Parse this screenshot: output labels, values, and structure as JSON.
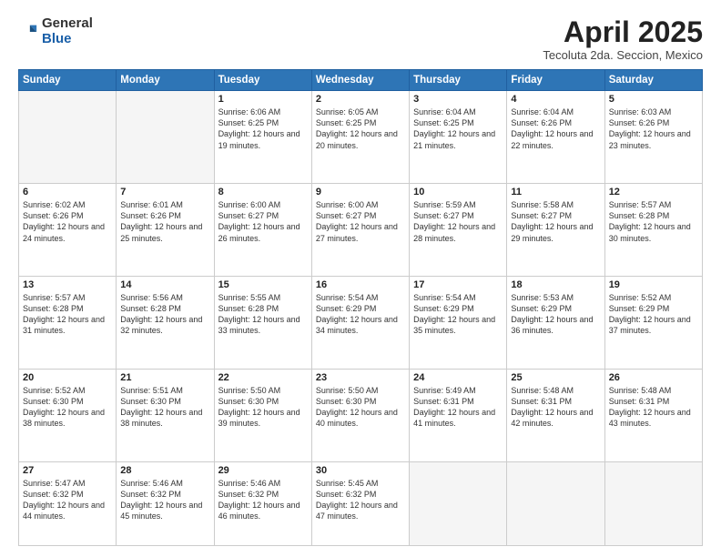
{
  "logo": {
    "general": "General",
    "blue": "Blue"
  },
  "title": "April 2025",
  "location": "Tecoluta 2da. Seccion, Mexico",
  "days_header": [
    "Sunday",
    "Monday",
    "Tuesday",
    "Wednesday",
    "Thursday",
    "Friday",
    "Saturday"
  ],
  "weeks": [
    [
      {
        "day": "",
        "info": ""
      },
      {
        "day": "",
        "info": ""
      },
      {
        "day": "1",
        "info": "Sunrise: 6:06 AM\nSunset: 6:25 PM\nDaylight: 12 hours and 19 minutes."
      },
      {
        "day": "2",
        "info": "Sunrise: 6:05 AM\nSunset: 6:25 PM\nDaylight: 12 hours and 20 minutes."
      },
      {
        "day": "3",
        "info": "Sunrise: 6:04 AM\nSunset: 6:25 PM\nDaylight: 12 hours and 21 minutes."
      },
      {
        "day": "4",
        "info": "Sunrise: 6:04 AM\nSunset: 6:26 PM\nDaylight: 12 hours and 22 minutes."
      },
      {
        "day": "5",
        "info": "Sunrise: 6:03 AM\nSunset: 6:26 PM\nDaylight: 12 hours and 23 minutes."
      }
    ],
    [
      {
        "day": "6",
        "info": "Sunrise: 6:02 AM\nSunset: 6:26 PM\nDaylight: 12 hours and 24 minutes."
      },
      {
        "day": "7",
        "info": "Sunrise: 6:01 AM\nSunset: 6:26 PM\nDaylight: 12 hours and 25 minutes."
      },
      {
        "day": "8",
        "info": "Sunrise: 6:00 AM\nSunset: 6:27 PM\nDaylight: 12 hours and 26 minutes."
      },
      {
        "day": "9",
        "info": "Sunrise: 6:00 AM\nSunset: 6:27 PM\nDaylight: 12 hours and 27 minutes."
      },
      {
        "day": "10",
        "info": "Sunrise: 5:59 AM\nSunset: 6:27 PM\nDaylight: 12 hours and 28 minutes."
      },
      {
        "day": "11",
        "info": "Sunrise: 5:58 AM\nSunset: 6:27 PM\nDaylight: 12 hours and 29 minutes."
      },
      {
        "day": "12",
        "info": "Sunrise: 5:57 AM\nSunset: 6:28 PM\nDaylight: 12 hours and 30 minutes."
      }
    ],
    [
      {
        "day": "13",
        "info": "Sunrise: 5:57 AM\nSunset: 6:28 PM\nDaylight: 12 hours and 31 minutes."
      },
      {
        "day": "14",
        "info": "Sunrise: 5:56 AM\nSunset: 6:28 PM\nDaylight: 12 hours and 32 minutes."
      },
      {
        "day": "15",
        "info": "Sunrise: 5:55 AM\nSunset: 6:28 PM\nDaylight: 12 hours and 33 minutes."
      },
      {
        "day": "16",
        "info": "Sunrise: 5:54 AM\nSunset: 6:29 PM\nDaylight: 12 hours and 34 minutes."
      },
      {
        "day": "17",
        "info": "Sunrise: 5:54 AM\nSunset: 6:29 PM\nDaylight: 12 hours and 35 minutes."
      },
      {
        "day": "18",
        "info": "Sunrise: 5:53 AM\nSunset: 6:29 PM\nDaylight: 12 hours and 36 minutes."
      },
      {
        "day": "19",
        "info": "Sunrise: 5:52 AM\nSunset: 6:29 PM\nDaylight: 12 hours and 37 minutes."
      }
    ],
    [
      {
        "day": "20",
        "info": "Sunrise: 5:52 AM\nSunset: 6:30 PM\nDaylight: 12 hours and 38 minutes."
      },
      {
        "day": "21",
        "info": "Sunrise: 5:51 AM\nSunset: 6:30 PM\nDaylight: 12 hours and 38 minutes."
      },
      {
        "day": "22",
        "info": "Sunrise: 5:50 AM\nSunset: 6:30 PM\nDaylight: 12 hours and 39 minutes."
      },
      {
        "day": "23",
        "info": "Sunrise: 5:50 AM\nSunset: 6:30 PM\nDaylight: 12 hours and 40 minutes."
      },
      {
        "day": "24",
        "info": "Sunrise: 5:49 AM\nSunset: 6:31 PM\nDaylight: 12 hours and 41 minutes."
      },
      {
        "day": "25",
        "info": "Sunrise: 5:48 AM\nSunset: 6:31 PM\nDaylight: 12 hours and 42 minutes."
      },
      {
        "day": "26",
        "info": "Sunrise: 5:48 AM\nSunset: 6:31 PM\nDaylight: 12 hours and 43 minutes."
      }
    ],
    [
      {
        "day": "27",
        "info": "Sunrise: 5:47 AM\nSunset: 6:32 PM\nDaylight: 12 hours and 44 minutes."
      },
      {
        "day": "28",
        "info": "Sunrise: 5:46 AM\nSunset: 6:32 PM\nDaylight: 12 hours and 45 minutes."
      },
      {
        "day": "29",
        "info": "Sunrise: 5:46 AM\nSunset: 6:32 PM\nDaylight: 12 hours and 46 minutes."
      },
      {
        "day": "30",
        "info": "Sunrise: 5:45 AM\nSunset: 6:32 PM\nDaylight: 12 hours and 47 minutes."
      },
      {
        "day": "",
        "info": ""
      },
      {
        "day": "",
        "info": ""
      },
      {
        "day": "",
        "info": ""
      }
    ]
  ]
}
